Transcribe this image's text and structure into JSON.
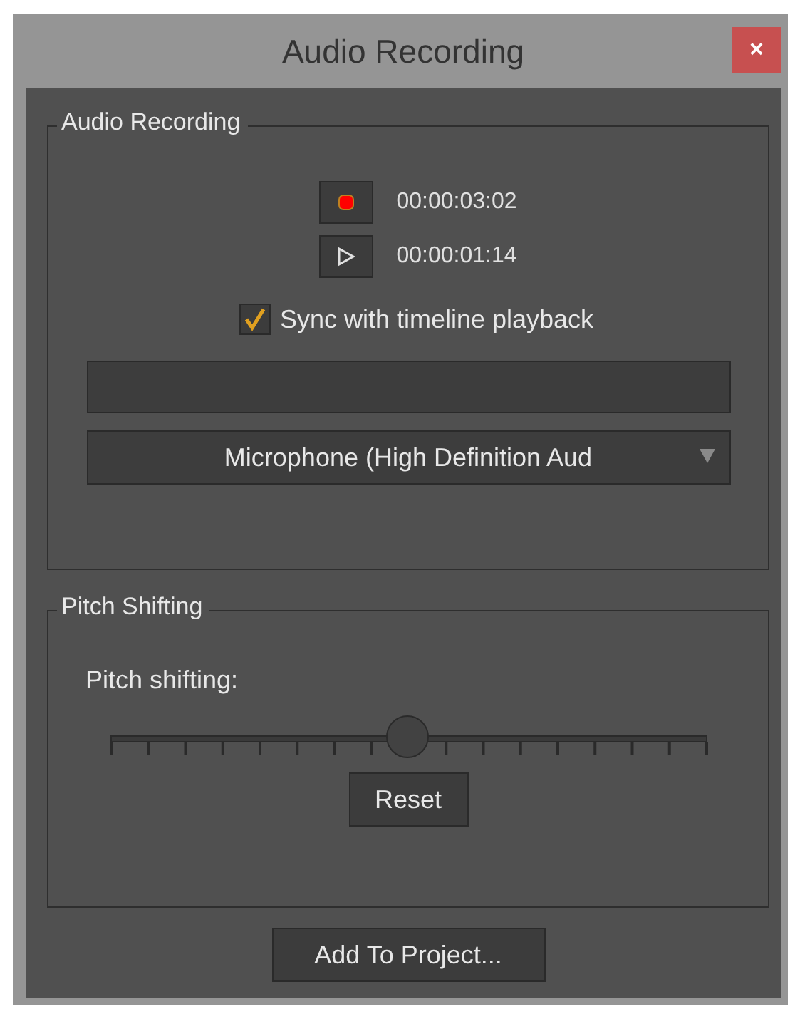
{
  "window": {
    "title": "Audio Recording",
    "close": "×"
  },
  "recording_group": {
    "title": "Audio Recording",
    "record": {
      "time": "00:00:03:02"
    },
    "play": {
      "time": "00:00:01:14"
    },
    "sync": {
      "label": "Sync with timeline playback",
      "checked": true
    },
    "level_meter": {
      "level": 0
    },
    "device": {
      "value": "Microphone (High Definition Aud"
    }
  },
  "pitch_group": {
    "title": "Pitch Shifting",
    "label": "Pitch shifting:",
    "slider": {
      "level": 0.5
    },
    "reset": "Reset"
  },
  "add_button": "Add To Project..."
}
